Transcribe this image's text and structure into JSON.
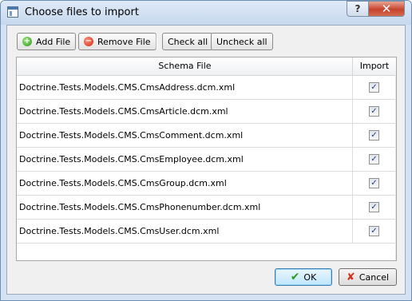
{
  "window": {
    "title": "Choose files to import",
    "help_glyph": "?",
    "close_glyph": "✕"
  },
  "toolbar": {
    "add_label": "Add File",
    "remove_label": "Remove File",
    "check_all_label": "Check all",
    "uncheck_all_label": "Uncheck all"
  },
  "table": {
    "columns": [
      "Schema File",
      "Import"
    ],
    "rows": [
      {
        "file": "Doctrine.Tests.Models.CMS.CmsAddress.dcm.xml",
        "import": true
      },
      {
        "file": "Doctrine.Tests.Models.CMS.CmsArticle.dcm.xml",
        "import": true
      },
      {
        "file": "Doctrine.Tests.Models.CMS.CmsComment.dcm.xml",
        "import": true
      },
      {
        "file": "Doctrine.Tests.Models.CMS.CmsEmployee.dcm.xml",
        "import": true
      },
      {
        "file": "Doctrine.Tests.Models.CMS.CmsGroup.dcm.xml",
        "import": true
      },
      {
        "file": "Doctrine.Tests.Models.CMS.CmsPhonenumber.dcm.xml",
        "import": true
      },
      {
        "file": "Doctrine.Tests.Models.CMS.CmsUser.dcm.xml",
        "import": true
      }
    ]
  },
  "footer": {
    "ok_label": "OK",
    "cancel_label": "Cancel"
  },
  "icons": {
    "app": "app-window-icon",
    "add": "add-icon",
    "remove": "remove-icon",
    "ok": "checkmark-icon",
    "cancel": "x-icon"
  },
  "colors": {
    "title_bar": "#c6d8ee",
    "close_button": "#c7432e",
    "add_icon": "#2f9a1b",
    "remove_icon": "#d12a12"
  }
}
